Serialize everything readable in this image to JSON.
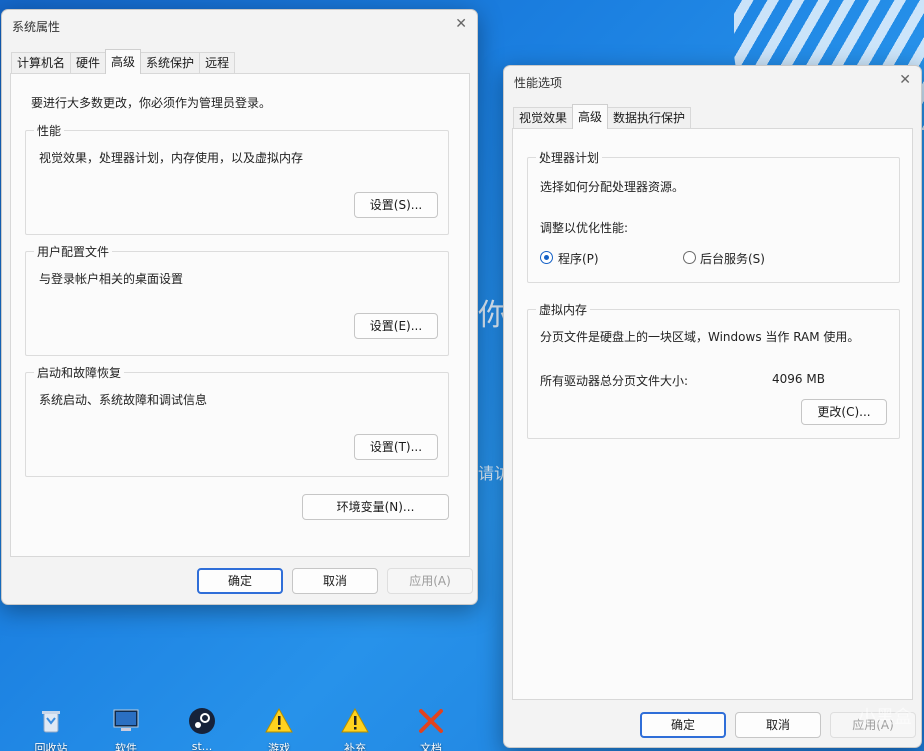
{
  "desktop": {
    "bg_text_1": "你",
    "bg_text_2": "请访",
    "watermark": "小黑盒",
    "icons": [
      {
        "name": "recycle-bin-icon",
        "label": "回收站"
      },
      {
        "name": "software-icon",
        "label": "软件"
      },
      {
        "name": "steam-icon",
        "label": "st..."
      },
      {
        "name": "warning-icon",
        "label": "游戏"
      },
      {
        "name": "warning-icon-2",
        "label": "补充"
      },
      {
        "name": "close-x-icon",
        "label": "文档"
      }
    ]
  },
  "system_properties": {
    "title": "系统属性",
    "tabs": [
      "计算机名",
      "硬件",
      "高级",
      "系统保护",
      "远程"
    ],
    "active_tab": "高级",
    "admin_note": "要进行大多数更改，你必须作为管理员登录。",
    "performance": {
      "title": "性能",
      "desc": "视觉效果，处理器计划，内存使用，以及虚拟内存",
      "button": "设置(S)..."
    },
    "user_profiles": {
      "title": "用户配置文件",
      "desc": "与登录帐户相关的桌面设置",
      "button": "设置(E)..."
    },
    "startup_recovery": {
      "title": "启动和故障恢复",
      "desc": "系统启动、系统故障和调试信息",
      "button": "设置(T)..."
    },
    "env_button": "环境变量(N)...",
    "ok": "确定",
    "cancel": "取消",
    "apply": "应用(A)"
  },
  "performance_options": {
    "title": "性能选项",
    "tabs": [
      "视觉效果",
      "高级",
      "数据执行保护"
    ],
    "active_tab": "高级",
    "processor": {
      "title": "处理器计划",
      "desc": "选择如何分配处理器资源。",
      "adjust_label": "调整以优化性能:",
      "option_programs": "程序(P)",
      "option_services": "后台服务(S)",
      "selected": "程序(P)"
    },
    "virtual_memory": {
      "title": "虚拟内存",
      "desc": "分页文件是硬盘上的一块区域，Windows 当作 RAM 使用。",
      "total_label": "所有驱动器总分页文件大小:",
      "total_value": "4096 MB",
      "change_button": "更改(C)..."
    },
    "ok": "确定",
    "cancel": "取消",
    "apply": "应用(A)"
  },
  "colors": {
    "accent": "#2f6ed8",
    "desktop": "#1b7fe0"
  }
}
